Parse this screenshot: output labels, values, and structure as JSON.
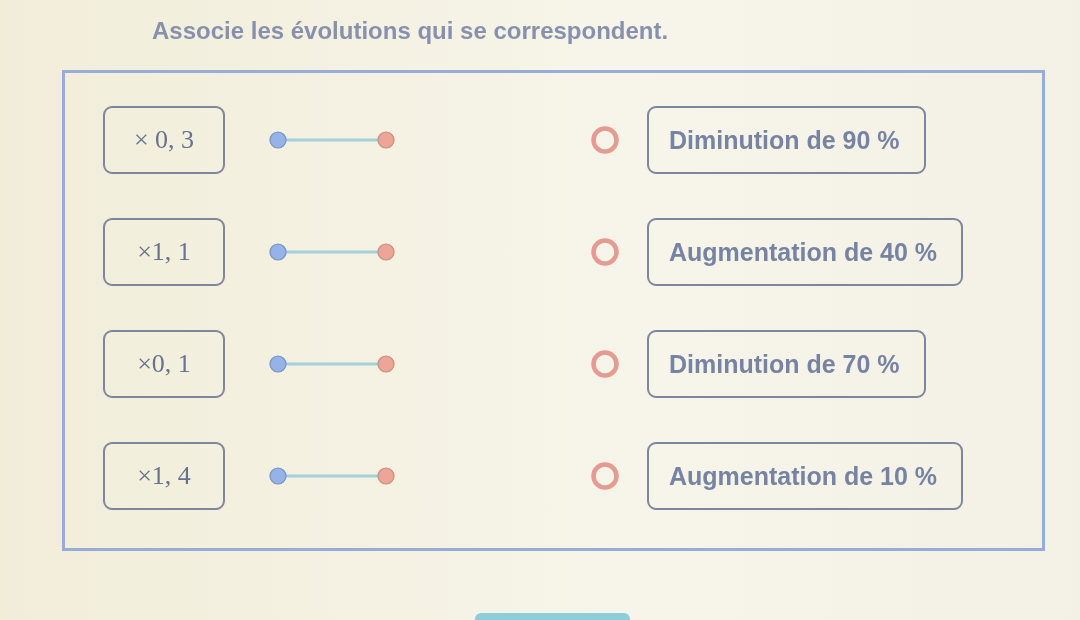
{
  "title": "Associe les évolutions qui se correspondent.",
  "left_items": [
    {
      "label": "× 0, 3"
    },
    {
      "label": "×1, 1"
    },
    {
      "label": "×0, 1"
    },
    {
      "label": "×1, 4"
    }
  ],
  "right_items": [
    {
      "label": "Diminution de 90 %"
    },
    {
      "label": "Augmentation de 40 %"
    },
    {
      "label": "Diminution de 70 %"
    },
    {
      "label": "Augmentation de 10 %"
    }
  ]
}
